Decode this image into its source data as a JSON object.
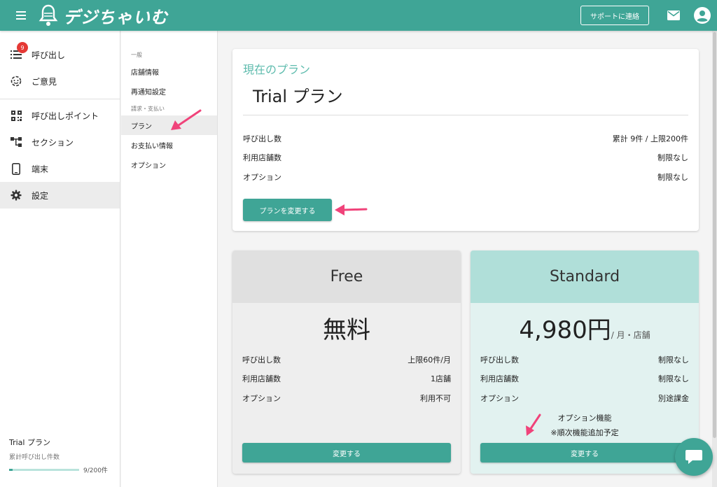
{
  "header": {
    "brand": "デジちゃいむ",
    "support_label": "サポートに連絡"
  },
  "colors": {
    "primary": "#3fa596",
    "badge": "#e53935",
    "accent_text": "#5fbcae",
    "arrow": "#f0437a"
  },
  "sidebar": {
    "items": [
      {
        "label": "呼び出し",
        "icon": "list-icon",
        "badge": "9"
      },
      {
        "label": "ご意見",
        "icon": "feedback-icon"
      },
      {
        "label": "呼び出しポイント",
        "icon": "qr-code-icon"
      },
      {
        "label": "セクション",
        "icon": "hierarchy-icon"
      },
      {
        "label": "端末",
        "icon": "phone-icon"
      },
      {
        "label": "設定",
        "icon": "gear-icon"
      }
    ],
    "plan_name": "Trial プラン",
    "count_label": "累計呼び出し件数",
    "usage_text": "9/200件",
    "usage_fraction": 0.045
  },
  "submenu": {
    "section_general": "一般",
    "store_info": "店舗情報",
    "renotify": "再通知設定",
    "section_billing": "請求・支払い",
    "plan": "プラン",
    "payment": "お支払い情報",
    "option": "オプション"
  },
  "current_plan": {
    "label": "現在のプラン",
    "name": "Trial プラン",
    "rows": [
      {
        "label": "呼び出し数",
        "value": "累計 9件 / 上限200件"
      },
      {
        "label": "利用店舗数",
        "value": "制限なし"
      },
      {
        "label": "オプション",
        "value": "制限なし"
      }
    ],
    "change_button": "プランを変更する"
  },
  "plans": {
    "free": {
      "name": "Free",
      "price": "無料",
      "rows": [
        {
          "label": "呼び出し数",
          "value": "上限60件/月"
        },
        {
          "label": "利用店舗数",
          "value": "1店舗"
        },
        {
          "label": "オプション",
          "value": "利用不可"
        }
      ],
      "button": "変更する"
    },
    "standard": {
      "name": "Standard",
      "price": "4,980円",
      "price_unit": "/ 月・店舗",
      "rows": [
        {
          "label": "呼び出し数",
          "value": "制限なし"
        },
        {
          "label": "利用店舗数",
          "value": "制限なし"
        },
        {
          "label": "オプション",
          "value": "別途課金"
        }
      ],
      "note_line1": "オプション機能",
      "note_line2": "※順次機能追加予定",
      "button": "変更する"
    }
  }
}
